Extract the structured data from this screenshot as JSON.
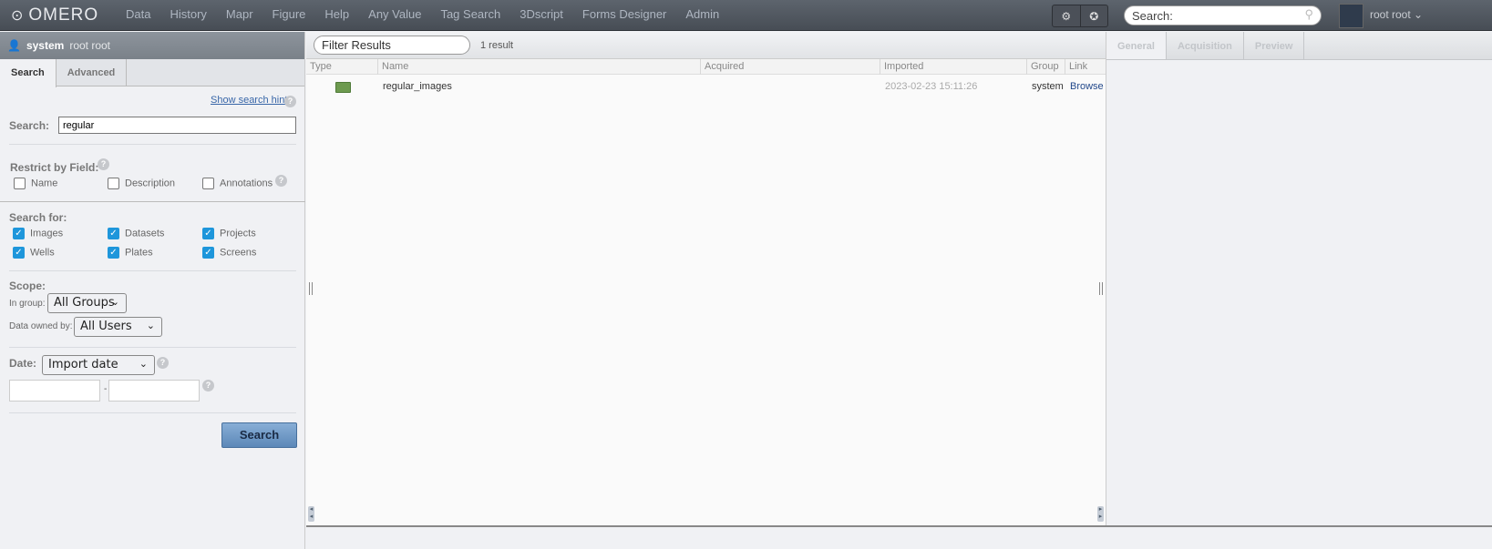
{
  "top": {
    "logo": "OMERO",
    "nav": [
      "Data",
      "History",
      "Mapr",
      "Figure",
      "Help",
      "Any Value",
      "Tag Search",
      "3Dscript",
      "Forms Designer",
      "Admin"
    ],
    "search_placeholder": "Search:",
    "user": "root root"
  },
  "left": {
    "group": "system",
    "user": "root root",
    "tabs": [
      "Search",
      "Advanced"
    ],
    "hints": "Show search hints",
    "search_label": "Search:",
    "search_value": "regular",
    "restrict_label": "Restrict by Field:",
    "restrict": [
      {
        "label": "Name",
        "checked": false
      },
      {
        "label": "Description",
        "checked": false
      },
      {
        "label": "Annotations",
        "checked": false
      }
    ],
    "search_for_label": "Search for:",
    "search_for": [
      {
        "label": "Images",
        "checked": true
      },
      {
        "label": "Datasets",
        "checked": true
      },
      {
        "label": "Projects",
        "checked": true
      },
      {
        "label": "Wells",
        "checked": true
      },
      {
        "label": "Plates",
        "checked": true
      },
      {
        "label": "Screens",
        "checked": true
      }
    ],
    "scope_label": "Scope:",
    "in_group_label": "In group:",
    "in_group": "All Groups",
    "owned_label": "Data owned by:",
    "owned": "All Users",
    "date_label": "Date:",
    "date_type": "Import date",
    "date_sep": "-",
    "search_button": "Search",
    "accent": "#1e96db"
  },
  "center": {
    "filter_placeholder": "Filter Results",
    "count": "1 result",
    "columns": [
      "Type",
      "Name",
      "Acquired",
      "Imported",
      "Group",
      "Link"
    ],
    "rows": [
      {
        "type": "folder-icon",
        "name": "regular_images",
        "acquired": "",
        "imported": "2023-02-23 15:11:26",
        "group": "system",
        "link": "Browse"
      }
    ]
  },
  "right": {
    "tabs": [
      "General",
      "Acquisition",
      "Preview"
    ]
  }
}
